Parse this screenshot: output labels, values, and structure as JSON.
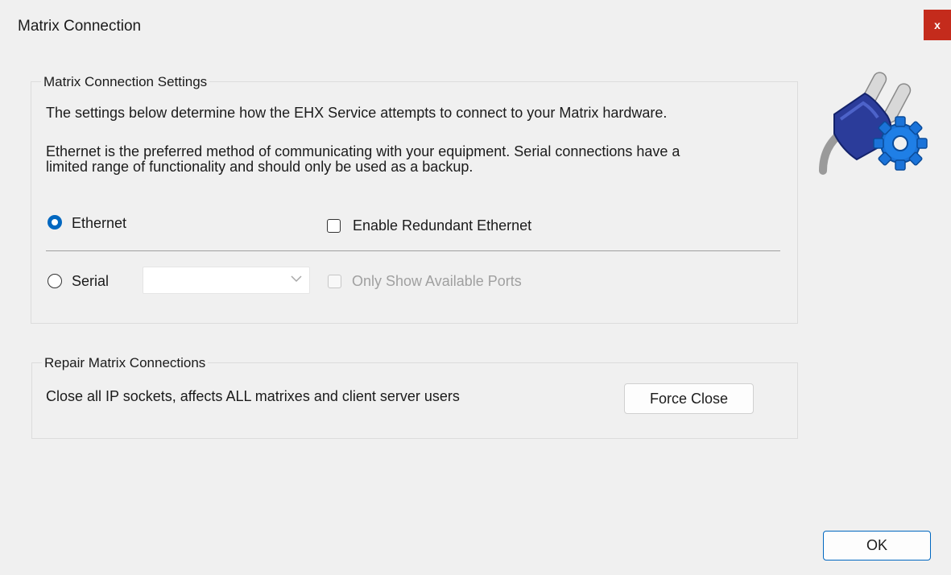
{
  "window": {
    "title": "Matrix Connection",
    "close_label": "x"
  },
  "settings_group": {
    "legend": "Matrix Connection Settings",
    "description_1": "The settings below determine how the EHX Service attempts to connect to your Matrix hardware.",
    "description_2_line1": "Ethernet is the preferred method of communicating with your equipment. Serial connections have a",
    "description_2_line2": "limited range of functionality and should only be used as a backup.",
    "ethernet_radio": {
      "label": "Ethernet",
      "checked": true
    },
    "redundant_checkbox": {
      "label": "Enable Redundant Ethernet",
      "checked": false
    },
    "serial_radio": {
      "label": "Serial",
      "checked": false
    },
    "serial_port_select": {
      "value": ""
    },
    "only_available_checkbox": {
      "label": "Only Show Available Ports",
      "checked": false,
      "disabled": true
    }
  },
  "repair_group": {
    "legend": "Repair Matrix Connections",
    "description": "Close all IP sockets, affects ALL matrixes and client server users",
    "force_close_label": "Force Close"
  },
  "footer": {
    "ok_label": "OK"
  },
  "icons": {
    "header_icon": "plug-gear-icon",
    "accent_color": "#0067c0",
    "close_color": "#c42b1c"
  }
}
